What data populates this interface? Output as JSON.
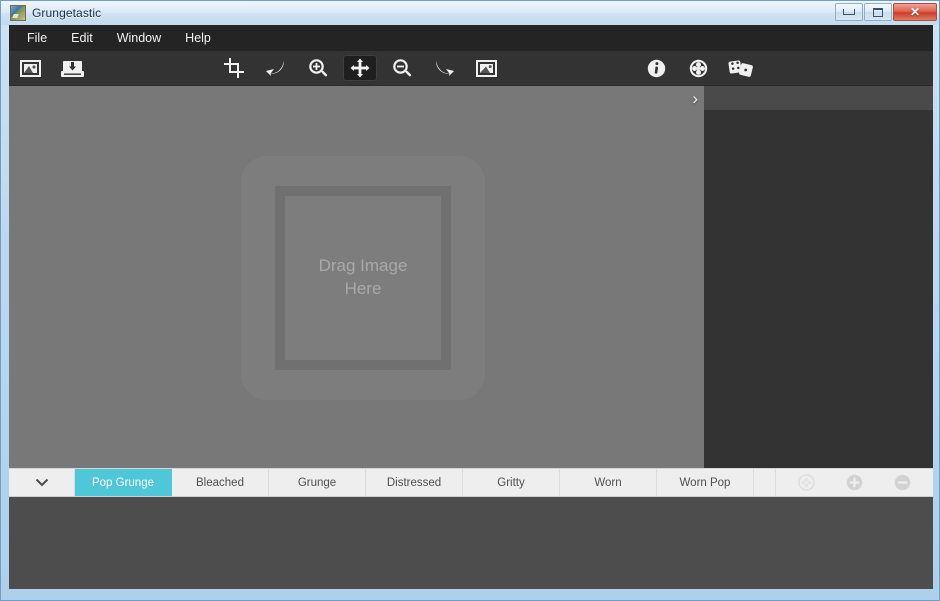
{
  "window": {
    "title": "Grungetastic",
    "icon": "app-image-icon",
    "controls": {
      "minimize": "Minimize",
      "maximize": "Maximize",
      "close": "Close"
    }
  },
  "menubar": {
    "items": [
      {
        "label": "File"
      },
      {
        "label": "Edit"
      },
      {
        "label": "Window"
      },
      {
        "label": "Help"
      }
    ]
  },
  "toolbar": {
    "left_group": [
      {
        "name": "open-image-icon",
        "title": "Open Image",
        "active": false
      },
      {
        "name": "save-image-icon",
        "title": "Save Image",
        "active": false
      }
    ],
    "center_group": [
      {
        "name": "crop-icon",
        "title": "Crop",
        "active": false
      },
      {
        "name": "undo-arrow-icon",
        "title": "Undo",
        "active": false
      },
      {
        "name": "zoom-in-icon",
        "title": "Zoom In",
        "active": false
      },
      {
        "name": "move-icon",
        "title": "Move",
        "active": true
      },
      {
        "name": "zoom-out-icon",
        "title": "Zoom Out",
        "active": false
      },
      {
        "name": "redo-arrow-icon",
        "title": "Redo",
        "active": false
      },
      {
        "name": "image-frame-icon",
        "title": "Image",
        "active": false
      }
    ],
    "right_group": [
      {
        "name": "info-icon",
        "title": "Info",
        "active": false
      },
      {
        "name": "settings-clover-icon",
        "title": "Settings",
        "active": false
      },
      {
        "name": "dice-icon",
        "title": "Randomize",
        "active": false
      }
    ]
  },
  "canvas": {
    "dropzone_text": "Drag Image\nHere",
    "dropzone_line1": "Drag Image",
    "dropzone_line2": "Here",
    "expand_chevron": "›",
    "background_color": "#787878"
  },
  "right_panel": {
    "header_color": "#4a4a4a",
    "body_color": "#333333"
  },
  "tabbar": {
    "dropdown_icon": "chevron-down-icon",
    "accent_color": "#4ec7d8",
    "tabs": [
      {
        "label": "Pop Grunge",
        "active": true
      },
      {
        "label": "Bleached",
        "active": false
      },
      {
        "label": "Grunge",
        "active": false
      },
      {
        "label": "Distressed",
        "active": false
      },
      {
        "label": "Gritty",
        "active": false
      },
      {
        "label": "Worn",
        "active": false
      },
      {
        "label": "Worn Pop",
        "active": false
      }
    ],
    "actions": [
      {
        "name": "preset-options-icon",
        "title": "Preset Options",
        "disabled": true
      },
      {
        "name": "add-preset-icon",
        "title": "Add Preset",
        "disabled": false
      },
      {
        "name": "remove-preset-icon",
        "title": "Remove Preset",
        "disabled": false
      }
    ]
  },
  "bottom_panel": {
    "background_color": "#4d4d4d"
  }
}
